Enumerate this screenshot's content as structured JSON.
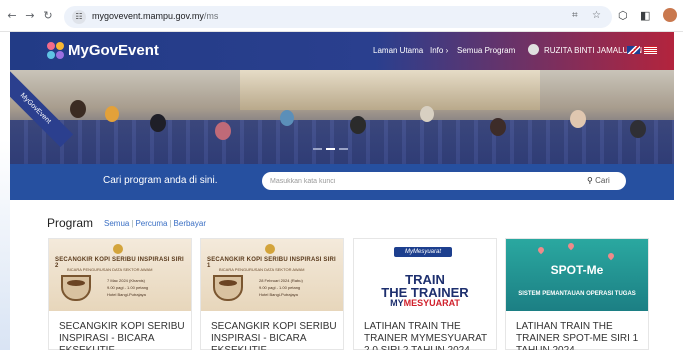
{
  "browser": {
    "url_host": "mygovevent.mampu.gov.my",
    "url_path": "/ms"
  },
  "header": {
    "logo_text": "MyGovEvent",
    "nav": {
      "home": "Laman Utama",
      "info": "Info",
      "programs": "Semua Program",
      "user": "RUZITA BINTI JAMALUDIN"
    }
  },
  "banner": {
    "ribbon_text": "MyGovEvent"
  },
  "search": {
    "label": "Cari program anda di sini.",
    "placeholder": "Masukkan kata kunci",
    "button": "Cari"
  },
  "program": {
    "title": "Program",
    "filters": [
      "Semua",
      "Percuma",
      "Berbayar"
    ],
    "cards": [
      {
        "thumb_heading": "SECANGKIR KOPI SERIBU INSPIRASI SIRI 2",
        "thumb_sub": "BICARA PENGURUSAN DATA SEKTOR AWAM",
        "thumb_date": "7 Mac 2024 (Khamis)",
        "thumb_time": "9.00 pagi - 1.00 petang",
        "thumb_venue": "Hotel Bangi-Putrajaya",
        "title": "SECANGKIR KOPI SERIBU INSPIRASI - BICARA EKSEKUTIF"
      },
      {
        "thumb_heading": "SECANGKIR KOPI SERIBU INSPIRASI SIRI 1",
        "thumb_sub": "BICARA PENGURUSAN DATA SEKTOR AWAM",
        "thumb_date": "28 Februari 2024 (Rabu)",
        "thumb_time": "9.00 pagi - 1.00 petang",
        "thumb_venue": "Hotel Bangi-Putrajaya",
        "title": "SECANGKIR KOPI SERIBU INSPIRASI - BICARA EKSEKUTIF"
      },
      {
        "thumb_logo": "MyMesyuarat",
        "thumb_line1": "TRAIN",
        "thumb_line2": "THE TRAINER",
        "thumb_line3a": "MY",
        "thumb_line3b": "MESYUARAT",
        "title": "LATIHAN TRAIN THE TRAINER MYMESYUARAT 2.0 SIRI 2 TAHUN 2024"
      },
      {
        "thumb_title": "SPOT-Me",
        "thumb_sub": "SISTEM PEMANTAUAN OPERASI TUGAS",
        "title": "LATIHAN TRAIN THE TRAINER SPOT-ME SIRI 1 TAHUN 2024"
      }
    ]
  },
  "colors": {
    "header_blue": "#223b86",
    "header_red": "#b3243d",
    "search_band": "#2650a0",
    "link": "#3a6fc4"
  }
}
